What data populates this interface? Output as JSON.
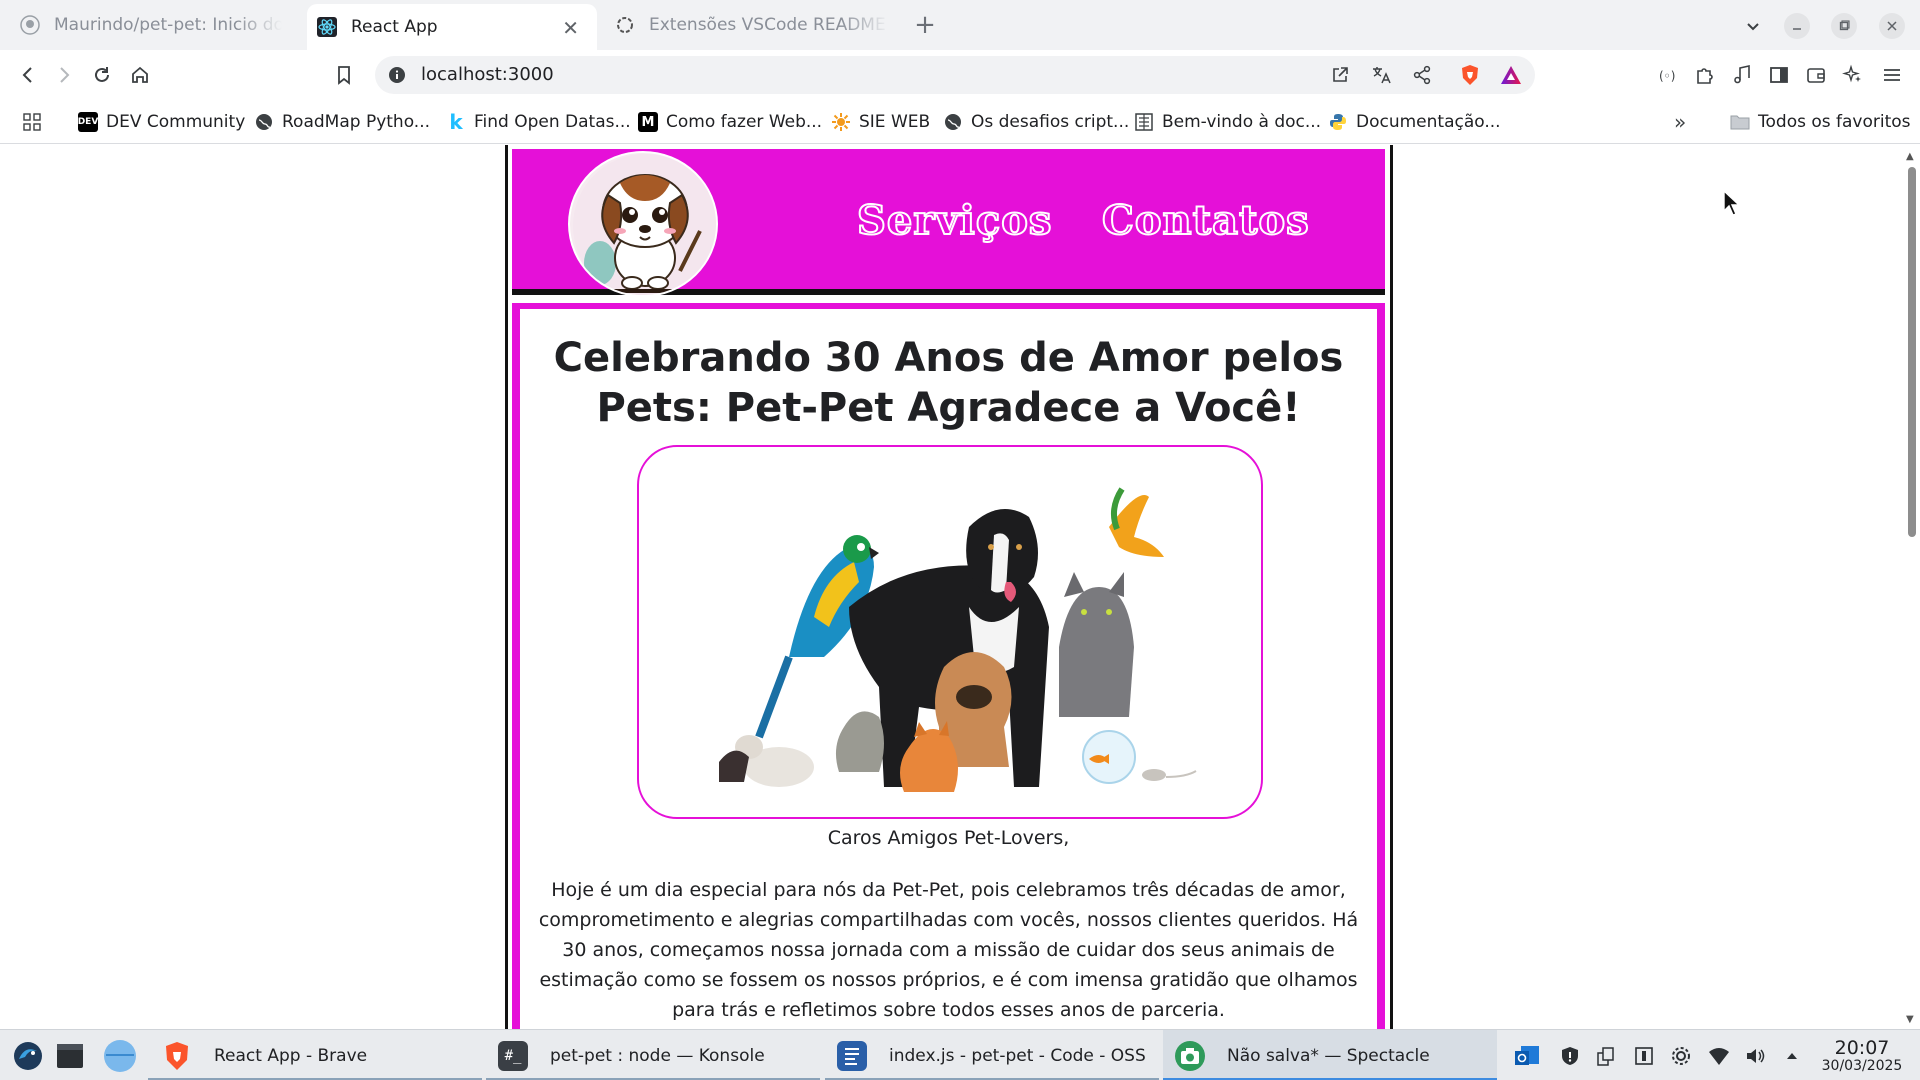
{
  "browser": {
    "tabs": [
      {
        "label": "Maurindo/pet-pet: Inicio do projeto",
        "icon": "github-icon"
      },
      {
        "label": "React App",
        "icon": "react-icon"
      },
      {
        "label": "Extensões VSCode README GitHub",
        "icon": "openai-icon"
      }
    ],
    "new_tab": "+",
    "url": "localhost:3000",
    "bookmarks": [
      {
        "label": "DEV Community",
        "icon": "DEV"
      },
      {
        "label": "RoadMap Pytho...",
        "icon": "globe"
      },
      {
        "label": "Find Open Datas...",
        "icon": "k"
      },
      {
        "label": "Como fazer Web...",
        "icon": "M"
      },
      {
        "label": "SIE WEB",
        "icon": "sie"
      },
      {
        "label": "Os desafios cript...",
        "icon": "globe"
      },
      {
        "label": "Bem-vindo à doc...",
        "icon": "doc"
      },
      {
        "label": "Documentação...",
        "icon": "python"
      }
    ],
    "bookmarks_more": "»",
    "all_favorites": "Todos os favoritos"
  },
  "site": {
    "nav": [
      "Serviços",
      "Contatos"
    ],
    "headline": "Celebrando 30 Anos de Amor pelos Pets: Pet-Pet Agradece a Você!",
    "greeting": "Caros Amigos Pet-Lovers,",
    "body": "Hoje é um dia especial para nós da Pet-Pet, pois celebramos três décadas de amor, comprometimento e alegrias compartilhadas com vocês, nossos clientes queridos. Há 30 anos, começamos nossa jornada com a missão de cuidar dos seus animais de estimação como se fossem os nossos próprios, e é com imensa gratidão que olhamos para trás e refletimos sobre todos esses anos de parceria."
  },
  "taskbar": {
    "tasks": [
      {
        "label": "React App - Brave"
      },
      {
        "label": "pet-pet : node — Konsole"
      },
      {
        "label": "index.js - pet-pet - Code - OSS"
      },
      {
        "label": "Não salva* — Spectacle"
      }
    ],
    "time": "20:07",
    "date": "30/03/2025"
  },
  "colors": {
    "brand_magenta": "#e510d8",
    "brave_orange": "#fb542b"
  }
}
